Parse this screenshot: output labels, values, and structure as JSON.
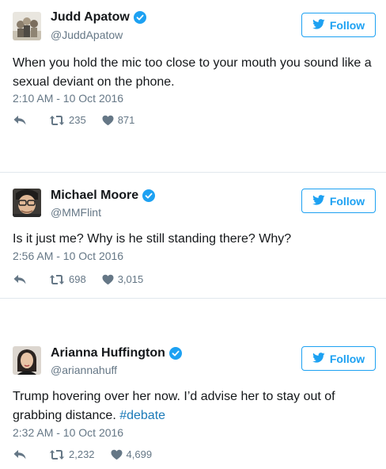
{
  "tweets": [
    {
      "name": "Judd Apatow",
      "handle": "@JuddApatow",
      "follow_label": "Follow",
      "text": "When you hold the mic too close to your mouth you sound like a sexual deviant on the phone.",
      "hashtag": "",
      "timestamp": "2:10 AM - 10 Oct 2016",
      "retweets": "235",
      "likes": "871"
    },
    {
      "name": "Michael Moore",
      "handle": "@MMFlint",
      "follow_label": "Follow",
      "text": "Is it just me? Why is he still standing there? Why?",
      "hashtag": "",
      "timestamp": "2:56 AM - 10 Oct 2016",
      "retweets": "698",
      "likes": "3,015"
    },
    {
      "name": "Arianna Huffington",
      "handle": "@ariannahuff",
      "follow_label": "Follow",
      "text": "Trump hovering over her now. I’d advise her to stay out of grabbing distance. ",
      "hashtag": "#debate",
      "timestamp": "2:32 AM - 10 Oct 2016",
      "retweets": "2,232",
      "likes": "4,699"
    }
  ],
  "colors": {
    "accent": "#1da1f2",
    "hashtag": "#1b7ab8",
    "muted": "#657786",
    "divider": "#e1e8ed"
  },
  "icons": [
    "verified-badge-icon",
    "twitter-bird-icon",
    "reply-icon",
    "retweet-icon",
    "heart-icon"
  ]
}
